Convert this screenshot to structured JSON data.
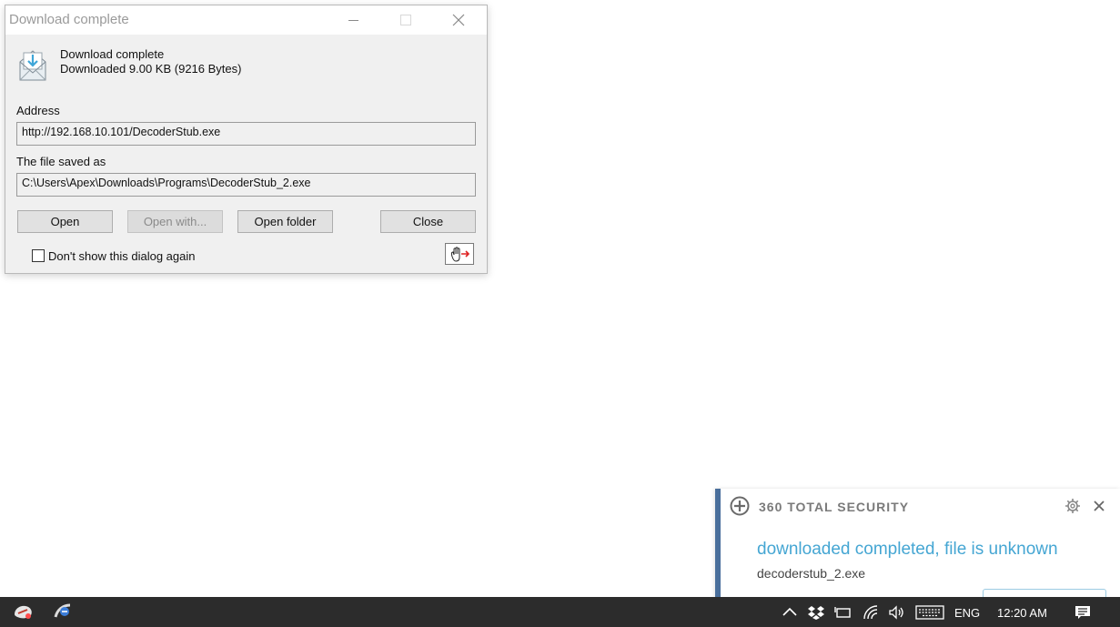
{
  "dialog": {
    "title": "Download complete",
    "status_heading": "Download complete",
    "status_detail": "Downloaded 9.00  KB (9216 Bytes)",
    "address_label": "Address",
    "address_value": "http://192.168.10.101/DecoderStub.exe",
    "saved_label": "The file saved as",
    "saved_value": "C:\\Users\\Apex\\Downloads\\Programs\\DecoderStub_2.exe",
    "buttons": {
      "open": "Open",
      "open_with": "Open with...",
      "open_folder": "Open folder",
      "close": "Close"
    },
    "checkbox_label": "Don't show this dialog again",
    "checkbox_checked": false,
    "icons": {
      "download": "download-envelope-icon",
      "drag": "drag-hand-icon"
    }
  },
  "popup": {
    "brand": "360 TOTAL SECURITY",
    "message": "downloaded completed, file is unknown",
    "filename": "decoderstub_2.exe",
    "colors": {
      "accent_bar": "#4a6f9c",
      "message": "#45a6d3"
    }
  },
  "taskbar": {
    "language": "ENG",
    "time": "12:20 AM",
    "tray_icons": [
      "chevron-up-icon",
      "dropbox-icon",
      "battery-icon",
      "wifi-icon",
      "volume-icon",
      "keyboard-icon",
      "notifications-icon"
    ]
  }
}
